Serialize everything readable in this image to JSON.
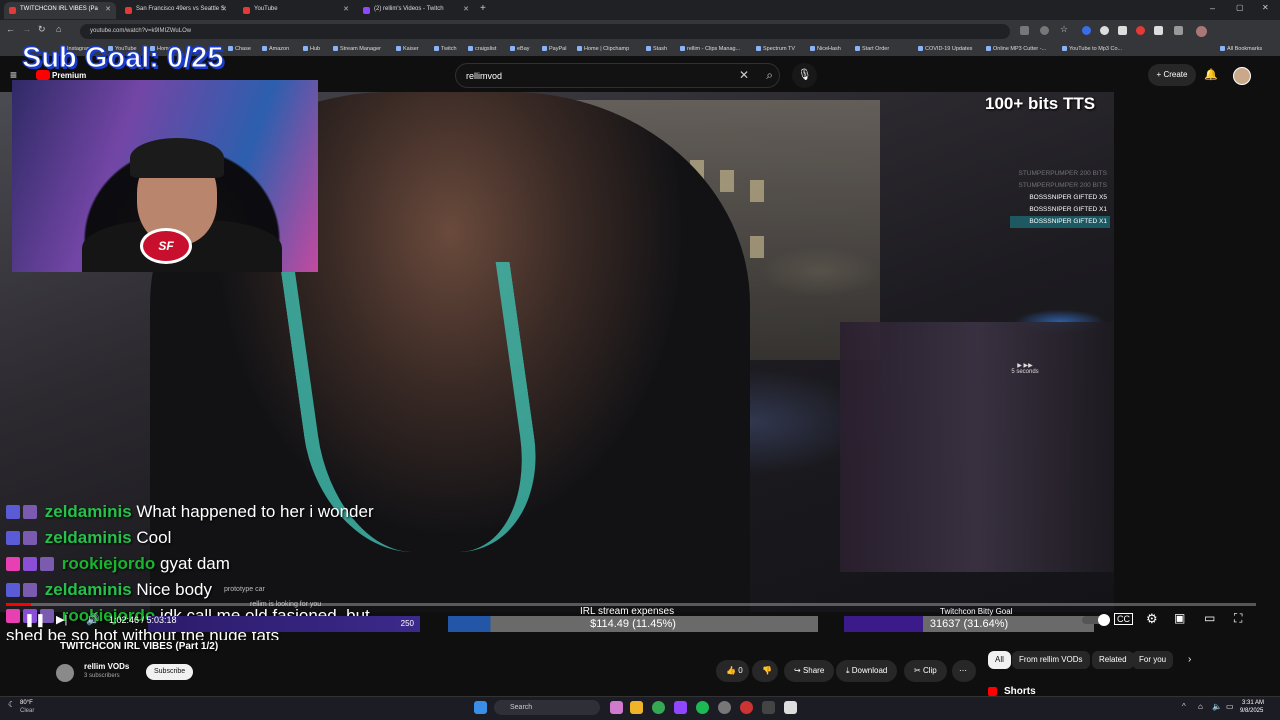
{
  "browser": {
    "tabs": [
      {
        "label": "TWITCHCON IRL VIBES (Pa"
      },
      {
        "label": "San Francisco 49ers vs Seattle S"
      },
      {
        "label": "YouTube"
      },
      {
        "label": "(2) rellim's Videos - Twitch"
      }
    ],
    "url": "youtube.com/watch?v=k9IMIZWuLOw",
    "bookmarks": [
      "Gmail",
      "Instagram",
      "YouTube",
      "Home",
      "Chase",
      "Amazon",
      "Hub",
      "Stream Manager",
      "Kaiser",
      "Twitch",
      "craigslist",
      "eBay",
      "PayPal",
      "Home | Clipchamp",
      "Stash",
      "rellim - Clips Manag...",
      "Spectrum TV",
      "NiceHash",
      "Start Order",
      "COVID-19 Updates",
      "Online MP3 Cutter -...",
      "YouTube to Mp3 Co..."
    ],
    "all_bookmarks": "All Bookmarks"
  },
  "youtube": {
    "logo_label": "Premium",
    "search_value": "rellimvod",
    "create_label": "Create"
  },
  "stream_overlay": {
    "sub_goal": "Sub Goal: 0/25",
    "tts_label": "100+ bits TTS",
    "events": [
      {
        "text": "STUMPERPUMPER 200 BITS",
        "style": "dim"
      },
      {
        "text": "STUMPERPUMPER 200 BITS",
        "style": "dim"
      },
      {
        "text": "BOSSSNIPER GIFTED X5",
        "style": "normal"
      },
      {
        "text": "BOSSSNIPER GIFTED X1",
        "style": "normal"
      },
      {
        "text": "BOSSSNIPER GIFTED X1",
        "style": "highlight"
      }
    ],
    "chat": [
      {
        "user": "zeldaminis",
        "message": "What happened to her i wonder"
      },
      {
        "user": "zeldaminis",
        "message": "Cool"
      },
      {
        "user": "rookiejordo",
        "message": "gyat dam"
      },
      {
        "user": "zeldaminis",
        "message": "Nice body"
      },
      {
        "user": "rookiejordo",
        "message": "idk call me old fasioned, but shed be so hot without the huge tats"
      }
    ],
    "notice": "prototype car",
    "notice2": "rellim is looking for you",
    "goals": {
      "left_value": "250",
      "middle_title": "IRL stream expenses",
      "middle_value": "$114.49 (11.45%)",
      "right_title": "Twitchcon Bitty Goal",
      "right_value": "31637 (31.64%)"
    },
    "skip_label": "5 seconds"
  },
  "player": {
    "time": "1:02:46 / 5:03:18",
    "progress_percent": 2
  },
  "video_info": {
    "title": "TWITCHCON IRL VIBES (Part 1/2)",
    "channel": "rellim VODs",
    "subscribers": "3 subscribers",
    "subscribe_label": "Subscribe",
    "likes": "0",
    "share_label": "Share",
    "download_label": "Download",
    "clip_label": "Clip"
  },
  "side_chips": [
    "All",
    "From rellim VODs",
    "Related",
    "For you"
  ],
  "shorts_label": "Shorts",
  "taskbar": {
    "weather_temp": "80°F",
    "weather_text": "Clear",
    "search_placeholder": "Search",
    "time": "3:31 AM",
    "date": "9/8/2025"
  }
}
